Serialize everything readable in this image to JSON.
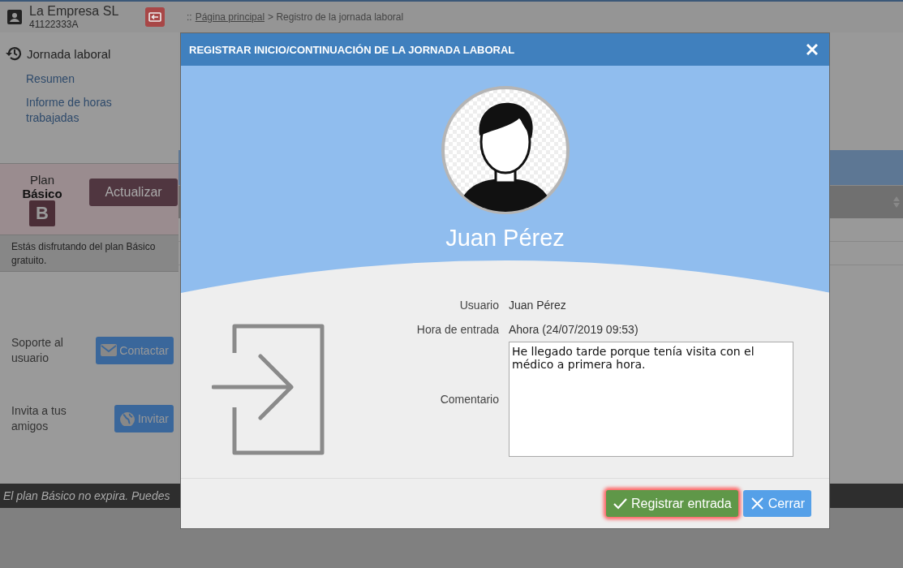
{
  "header": {
    "company": "La Empresa SL",
    "company_id": "41122333A",
    "breadcrumb": {
      "prefix": "::",
      "link": "Página principal",
      "current": "> Registro de la jornada laboral"
    }
  },
  "sidebar": {
    "section": "Jornada laboral",
    "items": [
      {
        "label": "Resumen"
      },
      {
        "label": "Informe de horas trabajadas"
      }
    ]
  },
  "plan": {
    "label": "Plan",
    "name": "Básico",
    "badge": "B",
    "button": "Actualizar",
    "note": "Estás disfrutando del plan Básico gratuito."
  },
  "actions": [
    {
      "label": "Soporte al usuario",
      "button": "Contactar",
      "kind": "mail"
    },
    {
      "label": "Invita a tus amigos",
      "button": "Invitar",
      "kind": "globe"
    }
  ],
  "notice": "El plan Básico no expira. Puedes",
  "dialog": {
    "title": "REGISTRAR INICIO/CONTINUACIÓN DE LA JORNADA LABORAL",
    "user_name": "Juan Pérez",
    "fields": [
      {
        "label": "Usuario",
        "value": "Juan Pérez"
      },
      {
        "label": "Hora de entrada",
        "value": "Ahora (24/07/2019 09:53)"
      }
    ],
    "comment": {
      "label": "Comentario",
      "value": "He llegado tarde porque tenía visita con el médico a primera hora."
    },
    "buttons": [
      {
        "label": "Registrar entrada",
        "kind": "confirm",
        "focused": true
      },
      {
        "label": "Cerrar",
        "kind": "cancel",
        "focused": false
      }
    ]
  }
}
